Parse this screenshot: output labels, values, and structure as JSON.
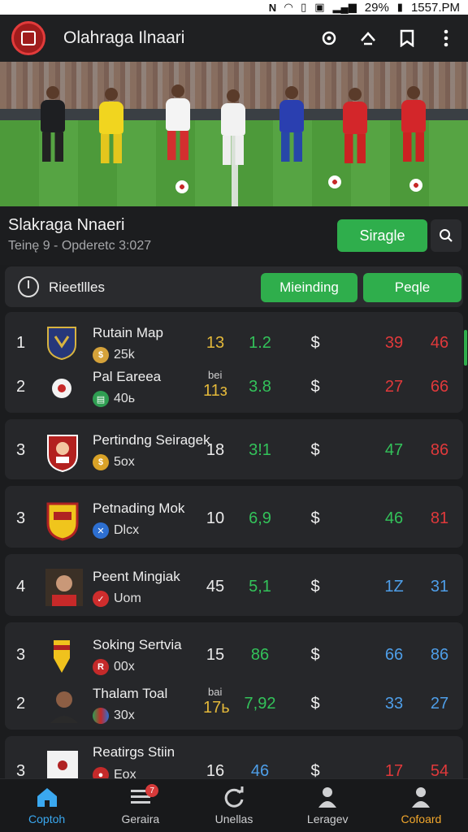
{
  "status_bar": {
    "battery": "29%",
    "time": "1557.PM"
  },
  "app": {
    "title": "Olahraga Ilnaari"
  },
  "section": {
    "title": "Slakraga Nnaeri",
    "subtitle": "Teinę 9 - Opderetc 3:027",
    "primary_button": "Siragle"
  },
  "filter": {
    "label": "Rieetllles",
    "tab_1": "Mieinding",
    "tab_2": "Peqle"
  },
  "colors": {
    "green": "#2fae4c",
    "yellow": "#e3b83a",
    "red": "#e0393b",
    "blue": "#4e9ee8",
    "orange_active": "#f2a72c"
  },
  "rows": [
    {
      "rank": "1",
      "name": "Rutain Map",
      "meta": "25k",
      "tag": "",
      "c1": "13",
      "c2": "1.2",
      "c3": "$",
      "c4": "39",
      "c5": "46",
      "crest": "shield-icon"
    },
    {
      "rank": "2",
      "name": "Pal Eareea",
      "meta": "40ь",
      "tag": "bei",
      "c1": "11з",
      "c2": "3.8",
      "c3": "$",
      "c4": "27",
      "c5": "66",
      "crest": "ball-icon"
    },
    {
      "rank": "3",
      "name": "Pertindng Seiragek",
      "meta": "5ox",
      "tag": "",
      "c1": "18",
      "c2": "3!1",
      "c3": "$",
      "c4": "47",
      "c5": "86",
      "crest": "mascot-crest-icon"
    },
    {
      "rank": "3",
      "name": "Petnading Mok",
      "meta": "Dlcx",
      "tag": "",
      "c1": "10",
      "c2": "6,9",
      "c3": "$",
      "c4": "46",
      "c5": "81",
      "crest": "yellow-shield-icon"
    },
    {
      "rank": "4",
      "name": "Peent Mingiak",
      "meta": "Uom",
      "tag": "",
      "c1": "45",
      "c2": "5,1",
      "c3": "$",
      "c4": "1Z",
      "c5": "31",
      "crest": "player-photo"
    },
    {
      "rank": "3",
      "name": "Soking Sertvia",
      "meta": "00x",
      "tag": "",
      "c1": "15",
      "c2": "86",
      "c3": "$",
      "c4": "66",
      "c5": "86",
      "crest": "pennant-crest-icon"
    },
    {
      "rank": "2",
      "name": "Thalam Toal",
      "meta": "30x",
      "tag": "bai",
      "c1": "17ь",
      "c2": "7,92",
      "c3": "$",
      "c4": "33",
      "c5": "27",
      "crest": "player-photo"
    },
    {
      "rank": "3",
      "name": "Reatirgs Stiin",
      "meta": "Eox",
      "tag": "",
      "c1": "16",
      "c2": "46",
      "c3": "$",
      "c4": "17",
      "c5": "54",
      "crest": "white-crest-icon"
    }
  ],
  "bottom_nav": [
    {
      "label": "Coptoh",
      "icon": "home-icon",
      "active": true
    },
    {
      "label": "Geraira",
      "icon": "list-icon",
      "badge": "7"
    },
    {
      "label": "Unellas",
      "icon": "refresh-icon"
    },
    {
      "label": "Leragev",
      "icon": "coach-icon"
    },
    {
      "label": "Cofoard",
      "icon": "user-icon"
    }
  ]
}
